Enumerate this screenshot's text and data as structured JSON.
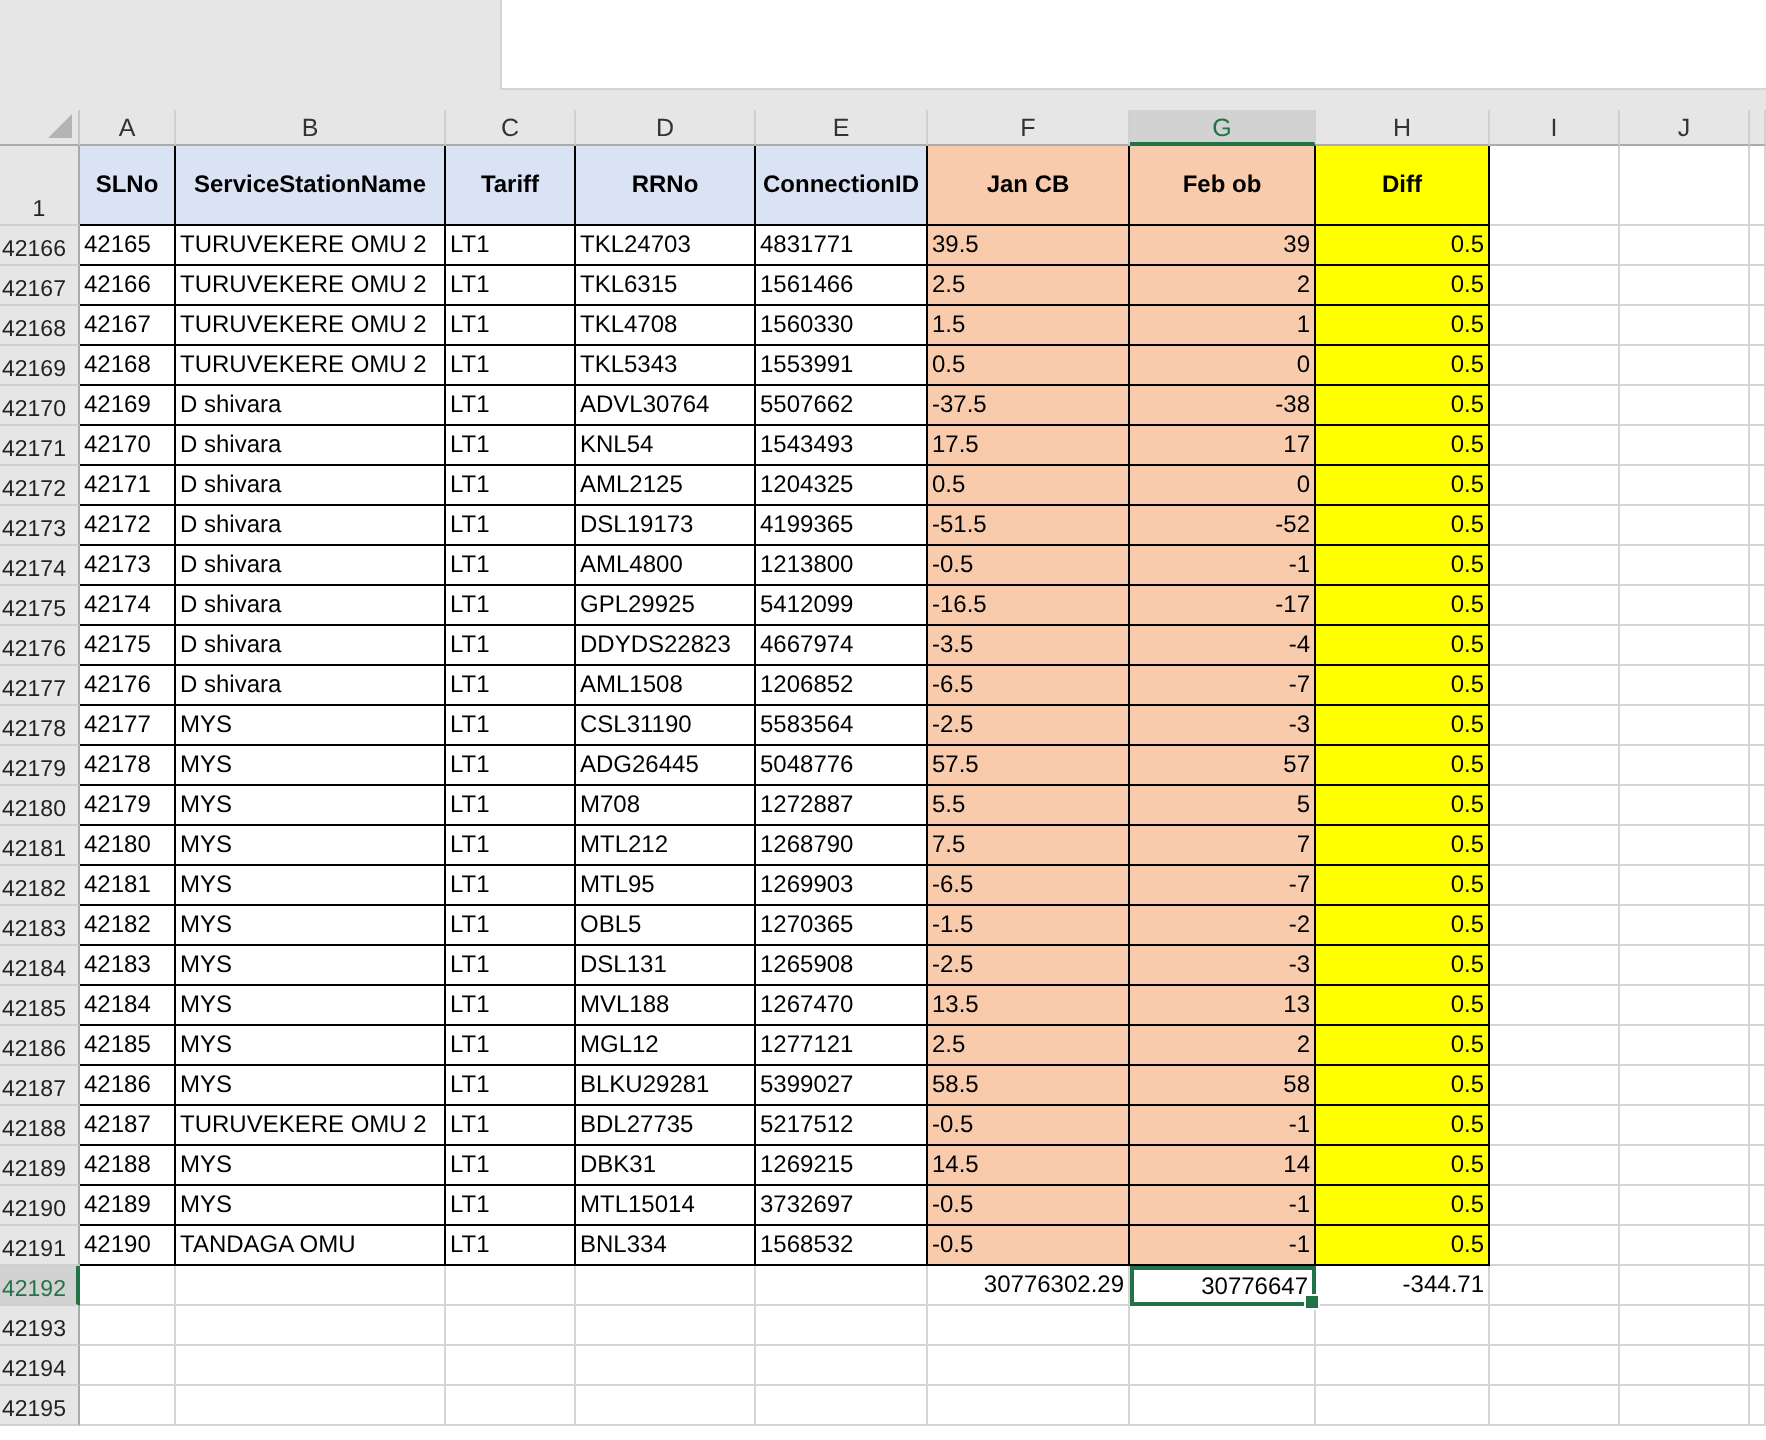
{
  "columns": [
    {
      "letter": "A",
      "selected": false,
      "color": "#ffffff",
      "kind": "text"
    },
    {
      "letter": "B",
      "selected": false,
      "color": "#ffffff",
      "kind": "text"
    },
    {
      "letter": "C",
      "selected": false,
      "color": "#ffffff",
      "kind": "text"
    },
    {
      "letter": "D",
      "selected": false,
      "color": "#ffffff",
      "kind": "text"
    },
    {
      "letter": "E",
      "selected": false,
      "color": "#ffffff",
      "kind": "text"
    },
    {
      "letter": "F",
      "selected": false,
      "color": "#f8cbad",
      "kind": "text"
    },
    {
      "letter": "G",
      "selected": true,
      "color": "#f8cbad",
      "kind": "number"
    },
    {
      "letter": "H",
      "selected": false,
      "color": "#ffff00",
      "kind": "number"
    },
    {
      "letter": "I",
      "selected": false
    },
    {
      "letter": "J",
      "selected": false
    }
  ],
  "header_row": {
    "row_number": "1",
    "cells": [
      {
        "text": "SLNo",
        "color": "#dae3f3"
      },
      {
        "text": "ServiceStationName",
        "color": "#dae3f3"
      },
      {
        "text": "Tariff",
        "color": "#dae3f3"
      },
      {
        "text": "RRNo",
        "color": "#dae3f3"
      },
      {
        "text": "ConnectionID",
        "color": "#dae3f3"
      },
      {
        "text": "Jan CB",
        "color": "#f8cbad"
      },
      {
        "text": "Feb ob",
        "color": "#f8cbad"
      },
      {
        "text": "Diff",
        "color": "#ffff00"
      }
    ]
  },
  "rows": [
    {
      "row_number": "42166",
      "cells": [
        "42165",
        "TURUVEKERE OMU 2",
        "LT1",
        "TKL24703",
        "4831771",
        "39.5",
        "39",
        "0.5"
      ]
    },
    {
      "row_number": "42167",
      "cells": [
        "42166",
        "TURUVEKERE OMU 2",
        "LT1",
        "TKL6315",
        "1561466",
        "2.5",
        "2",
        "0.5"
      ]
    },
    {
      "row_number": "42168",
      "cells": [
        "42167",
        "TURUVEKERE OMU 2",
        "LT1",
        "TKL4708",
        "1560330",
        "1.5",
        "1",
        "0.5"
      ]
    },
    {
      "row_number": "42169",
      "cells": [
        "42168",
        "TURUVEKERE OMU 2",
        "LT1",
        "TKL5343",
        "1553991",
        "0.5",
        "0",
        "0.5"
      ]
    },
    {
      "row_number": "42170",
      "cells": [
        "42169",
        "D shivara",
        "LT1",
        "ADVL30764",
        "5507662",
        "-37.5",
        "-38",
        "0.5"
      ]
    },
    {
      "row_number": "42171",
      "cells": [
        "42170",
        "D shivara",
        "LT1",
        "KNL54",
        "1543493",
        "17.5",
        "17",
        "0.5"
      ]
    },
    {
      "row_number": "42172",
      "cells": [
        "42171",
        "D shivara",
        "LT1",
        "AML2125",
        "1204325",
        "0.5",
        "0",
        "0.5"
      ]
    },
    {
      "row_number": "42173",
      "cells": [
        "42172",
        "D shivara",
        "LT1",
        "DSL19173",
        "4199365",
        "-51.5",
        "-52",
        "0.5"
      ]
    },
    {
      "row_number": "42174",
      "cells": [
        "42173",
        "D shivara",
        "LT1",
        "AML4800",
        "1213800",
        "-0.5",
        "-1",
        "0.5"
      ]
    },
    {
      "row_number": "42175",
      "cells": [
        "42174",
        "D shivara",
        "LT1",
        "GPL29925",
        "5412099",
        "-16.5",
        "-17",
        "0.5"
      ]
    },
    {
      "row_number": "42176",
      "cells": [
        "42175",
        "D shivara",
        "LT1",
        "DDYDS22823",
        "4667974",
        "-3.5",
        "-4",
        "0.5"
      ]
    },
    {
      "row_number": "42177",
      "cells": [
        "42176",
        "D shivara",
        "LT1",
        "AML1508",
        "1206852",
        "-6.5",
        "-7",
        "0.5"
      ]
    },
    {
      "row_number": "42178",
      "cells": [
        "42177",
        "MYS",
        "LT1",
        "CSL31190",
        "5583564",
        "-2.5",
        "-3",
        "0.5"
      ]
    },
    {
      "row_number": "42179",
      "cells": [
        "42178",
        "MYS",
        "LT1",
        "ADG26445",
        "5048776",
        "57.5",
        "57",
        "0.5"
      ]
    },
    {
      "row_number": "42180",
      "cells": [
        "42179",
        "MYS",
        "LT1",
        "M708",
        "1272887",
        "5.5",
        "5",
        "0.5"
      ]
    },
    {
      "row_number": "42181",
      "cells": [
        "42180",
        "MYS",
        "LT1",
        "MTL212",
        "1268790",
        "7.5",
        "7",
        "0.5"
      ]
    },
    {
      "row_number": "42182",
      "cells": [
        "42181",
        "MYS",
        "LT1",
        "MTL95",
        "1269903",
        "-6.5",
        "-7",
        "0.5"
      ]
    },
    {
      "row_number": "42183",
      "cells": [
        "42182",
        "MYS",
        "LT1",
        "OBL5",
        "1270365",
        "-1.5",
        "-2",
        "0.5"
      ]
    },
    {
      "row_number": "42184",
      "cells": [
        "42183",
        "MYS",
        "LT1",
        "DSL131",
        "1265908",
        "-2.5",
        "-3",
        "0.5"
      ]
    },
    {
      "row_number": "42185",
      "cells": [
        "42184",
        "MYS",
        "LT1",
        "MVL188",
        "1267470",
        "13.5",
        "13",
        "0.5"
      ]
    },
    {
      "row_number": "42186",
      "cells": [
        "42185",
        "MYS",
        "LT1",
        "MGL12",
        "1277121",
        "2.5",
        "2",
        "0.5"
      ]
    },
    {
      "row_number": "42187",
      "cells": [
        "42186",
        "MYS",
        "LT1",
        "BLKU29281",
        "5399027",
        "58.5",
        "58",
        "0.5"
      ]
    },
    {
      "row_number": "42188",
      "cells": [
        "42187",
        "TURUVEKERE OMU 2",
        "LT1",
        "BDL27735",
        "5217512",
        "-0.5",
        "-1",
        "0.5"
      ]
    },
    {
      "row_number": "42189",
      "cells": [
        "42188",
        "MYS",
        "LT1",
        "DBK31",
        "1269215",
        "14.5",
        "14",
        "0.5"
      ]
    },
    {
      "row_number": "42190",
      "cells": [
        "42189",
        "MYS",
        "LT1",
        "MTL15014",
        "3732697",
        "-0.5",
        "-1",
        "0.5"
      ]
    },
    {
      "row_number": "42191",
      "cells": [
        "42190",
        "TANDAGA OMU",
        "LT1",
        "BNL334",
        "1568532",
        "-0.5",
        "-1",
        "0.5"
      ]
    }
  ],
  "total_row": {
    "row_number": "42192",
    "selected": true,
    "cells": [
      {
        "value": "30776302.29",
        "active": false
      },
      {
        "value": "30776647",
        "active": true
      },
      {
        "value": "-344.71",
        "active": false
      }
    ]
  },
  "empty_rows": [
    {
      "row_number": "42193"
    },
    {
      "row_number": "42194"
    },
    {
      "row_number": "42195"
    }
  ]
}
